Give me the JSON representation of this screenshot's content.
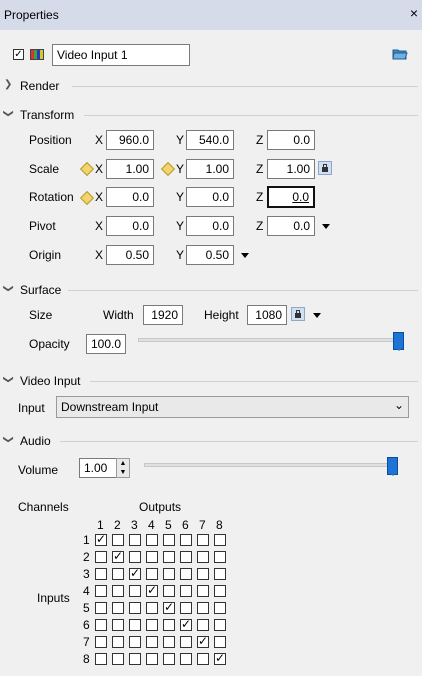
{
  "panel": {
    "title": "Properties",
    "close_label": "×"
  },
  "layer": {
    "enabled": true,
    "name": "Video Input 1"
  },
  "sections": {
    "render": "Render",
    "transform": "Transform",
    "surface": "Surface",
    "video_input": "Video Input",
    "audio": "Audio"
  },
  "transform": {
    "position": {
      "label": "Position",
      "x": "960.0",
      "y": "540.0",
      "z": "0.0"
    },
    "scale": {
      "label": "Scale",
      "x": "1.00",
      "y": "1.00",
      "z": "1.00"
    },
    "rotation": {
      "label": "Rotation",
      "x": "0.0",
      "y": "0.0",
      "z": "0.0"
    },
    "pivot": {
      "label": "Pivot",
      "x": "0.0",
      "y": "0.0",
      "z": "0.0"
    },
    "origin": {
      "label": "Origin",
      "x": "0.50",
      "y": "0.50"
    },
    "axis": {
      "x": "X",
      "y": "Y",
      "z": "Z"
    }
  },
  "surface": {
    "size_label": "Size",
    "width_label": "Width",
    "width": "1920",
    "height_label": "Height",
    "height": "1080",
    "opacity_label": "Opacity",
    "opacity": "100.0",
    "opacity_fraction": 1.0
  },
  "video_input": {
    "input_label": "Input",
    "input_value": "Downstream Input"
  },
  "audio": {
    "volume_label": "Volume",
    "volume": "1.00",
    "volume_fraction": 1.0,
    "channels_label": "Channels",
    "outputs_label": "Outputs",
    "inputs_label": "Inputs",
    "output_numbers": [
      "1",
      "2",
      "3",
      "4",
      "5",
      "6",
      "7",
      "8"
    ],
    "input_numbers": [
      "1",
      "2",
      "3",
      "4",
      "5",
      "6",
      "7",
      "8"
    ],
    "routing": [
      [
        1,
        0,
        0,
        0,
        0,
        0,
        0,
        0
      ],
      [
        0,
        1,
        0,
        0,
        0,
        0,
        0,
        0
      ],
      [
        0,
        0,
        1,
        0,
        0,
        0,
        0,
        0
      ],
      [
        0,
        0,
        0,
        1,
        0,
        0,
        0,
        0
      ],
      [
        0,
        0,
        0,
        0,
        1,
        0,
        0,
        0
      ],
      [
        0,
        0,
        0,
        0,
        0,
        1,
        0,
        0
      ],
      [
        0,
        0,
        0,
        0,
        0,
        0,
        1,
        0
      ],
      [
        0,
        0,
        0,
        0,
        0,
        0,
        0,
        1
      ]
    ]
  },
  "colors": {
    "accent": "#1e73d6",
    "titlebar": "#d6dbe9",
    "keyframe": "#f3d36b"
  },
  "icons": [
    "close-icon",
    "media-type-icon",
    "folder-icon",
    "chevron-right-icon",
    "chevron-down-icon",
    "keyframe-diamond-icon",
    "lock-icon",
    "dropdown-arrow-icon"
  ]
}
